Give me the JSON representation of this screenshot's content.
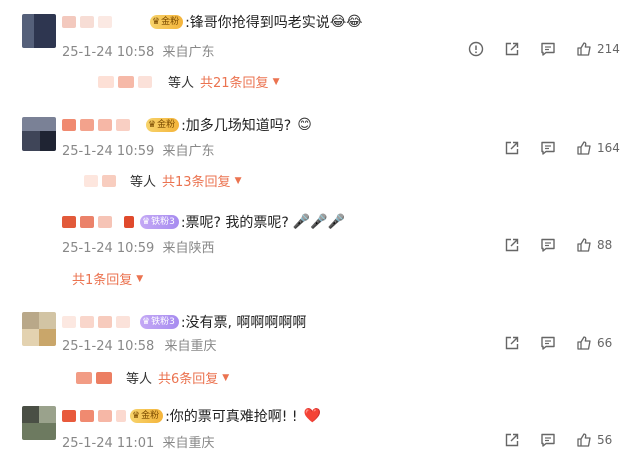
{
  "comments": [
    {
      "badge_label": "金粉",
      "badge_style": "gold",
      "text": ":锋哥你抢得到吗老实说",
      "emojis": [
        "😂",
        "😂"
      ],
      "time": "25-1-24 10:58",
      "location": "来自广东",
      "likes": "214",
      "has_report": true,
      "has_share": true,
      "replies_prefix": "等人",
      "replies_label": "共21条回复"
    },
    {
      "badge_label": "金粉",
      "badge_style": "gold",
      "text": ":加多几场知道吗?",
      "emojis": [
        "😊"
      ],
      "time": "25-1-24 10:59",
      "location": "来自广东",
      "likes": "164",
      "has_report": false,
      "has_share": true,
      "replies_prefix": "等人",
      "replies_label": "共13条回复"
    },
    {
      "badge_label": "铁粉3",
      "badge_style": "purple",
      "text": ":票呢? 我的票呢?",
      "emojis": [
        "🎤",
        "🎤",
        "🎤"
      ],
      "time": "25-1-24 10:59",
      "location": "来自陕西",
      "likes": "88",
      "has_report": false,
      "has_share": true,
      "replies_prefix": "",
      "replies_label": "共1条回复"
    },
    {
      "badge_label": "铁粉3",
      "badge_style": "purple",
      "text": ":没有票, 啊啊啊啊啊",
      "emojis": [],
      "time": "25-1-24 10:58",
      "location": "来自重庆",
      "likes": "66",
      "has_report": false,
      "has_share": true,
      "replies_prefix": "等人",
      "replies_label": "共6条回复"
    },
    {
      "badge_label": "金粉",
      "badge_style": "gold",
      "text": ":你的票可真难抢啊! !",
      "emojis": [
        "❤️"
      ],
      "time": "25-1-24 11:01",
      "location": "来自重庆",
      "likes": "56",
      "has_report": false,
      "has_share": true,
      "replies_prefix": "",
      "replies_label": ""
    }
  ],
  "colors": {
    "accent": "#eb7350",
    "meta": "#888888",
    "heart": "#e02b3c"
  },
  "icons": [
    "report-icon",
    "share-icon",
    "comment-icon",
    "like-icon",
    "chevron-down-icon"
  ]
}
